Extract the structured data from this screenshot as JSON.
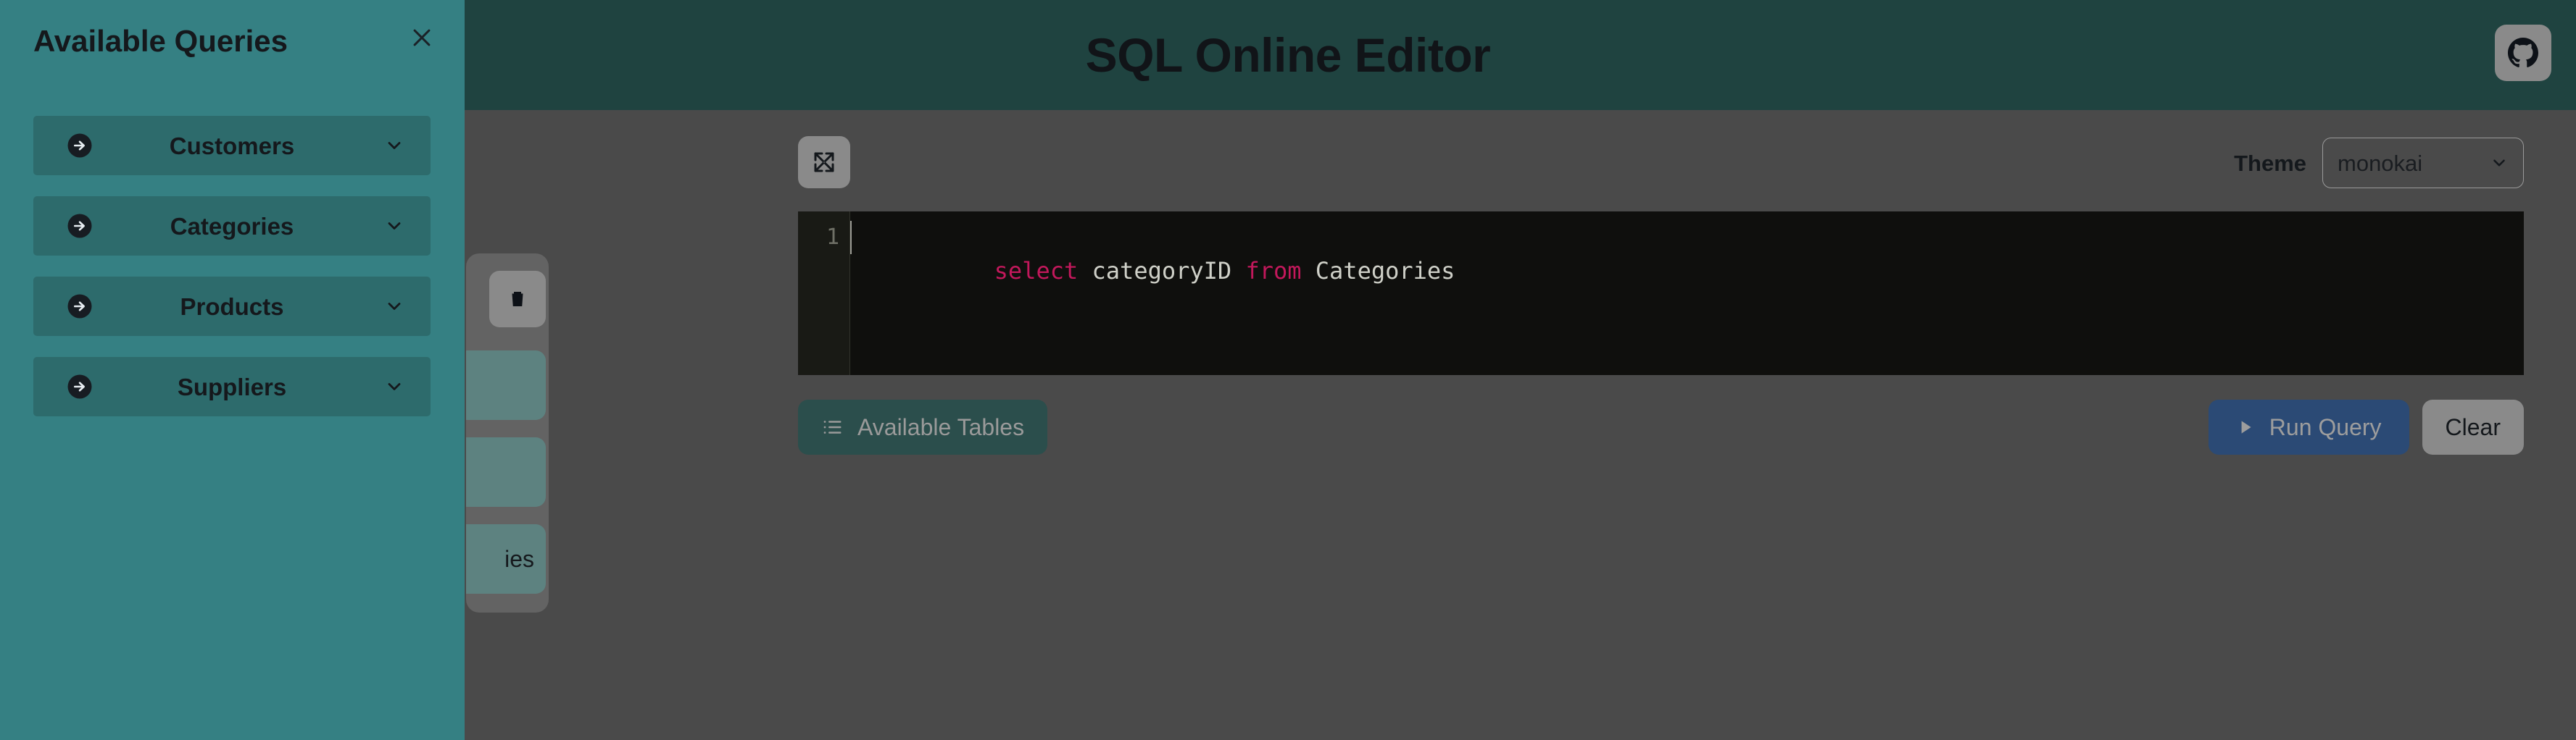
{
  "header": {
    "title": "SQL Online Editor",
    "github_icon": "github-icon"
  },
  "editor_toolbar": {
    "expand_icon": "fullscreen-expand-icon",
    "theme_label": "Theme",
    "theme_selected": "monokai",
    "chevron_icon": "chevron-down-icon"
  },
  "code_editor": {
    "line_numbers": [
      "1"
    ],
    "tokens": [
      {
        "text": "select",
        "type": "keyword"
      },
      {
        "text": " categoryID ",
        "type": "plain"
      },
      {
        "text": "from",
        "type": "keyword"
      },
      {
        "text": " Categories",
        "type": "plain"
      }
    ],
    "full_text": "select categoryID from Categories"
  },
  "action_bar": {
    "available_tables_label": "Available Tables",
    "available_tables_icon": "list-icon",
    "run_query_label": "Run Query",
    "run_query_icon": "play-icon",
    "clear_label": "Clear"
  },
  "obscured_panel": {
    "delete_icon": "trash-icon",
    "items": [
      {
        "label": ""
      },
      {
        "label": ""
      },
      {
        "label": "ies"
      }
    ]
  },
  "sidebar": {
    "title": "Available Queries",
    "close_icon": "close-icon",
    "items": [
      {
        "label": "Customers",
        "arrow_icon": "arrow-right-circle-icon",
        "chevron_icon": "chevron-down-icon"
      },
      {
        "label": "Categories",
        "arrow_icon": "arrow-right-circle-icon",
        "chevron_icon": "chevron-down-icon"
      },
      {
        "label": "Products",
        "arrow_icon": "arrow-right-circle-icon",
        "chevron_icon": "chevron-down-icon"
      },
      {
        "label": "Suppliers",
        "arrow_icon": "arrow-right-circle-icon",
        "chevron_icon": "chevron-down-icon"
      }
    ]
  },
  "colors": {
    "header_bg": "#1f4340",
    "sidebar_bg": "#358083",
    "accordion_bg": "#2d6b6c",
    "workspace_bg": "#4a4a4a",
    "editor_bg": "#0f0f0d",
    "gutter_bg": "#191a15",
    "keyword": "#c2185b",
    "code_text": "#cfd0c8",
    "run_query_bg": "#2b4a75",
    "available_tables_bg": "#2b4e4c",
    "neutral_btn_bg": "#8a8a8a"
  }
}
